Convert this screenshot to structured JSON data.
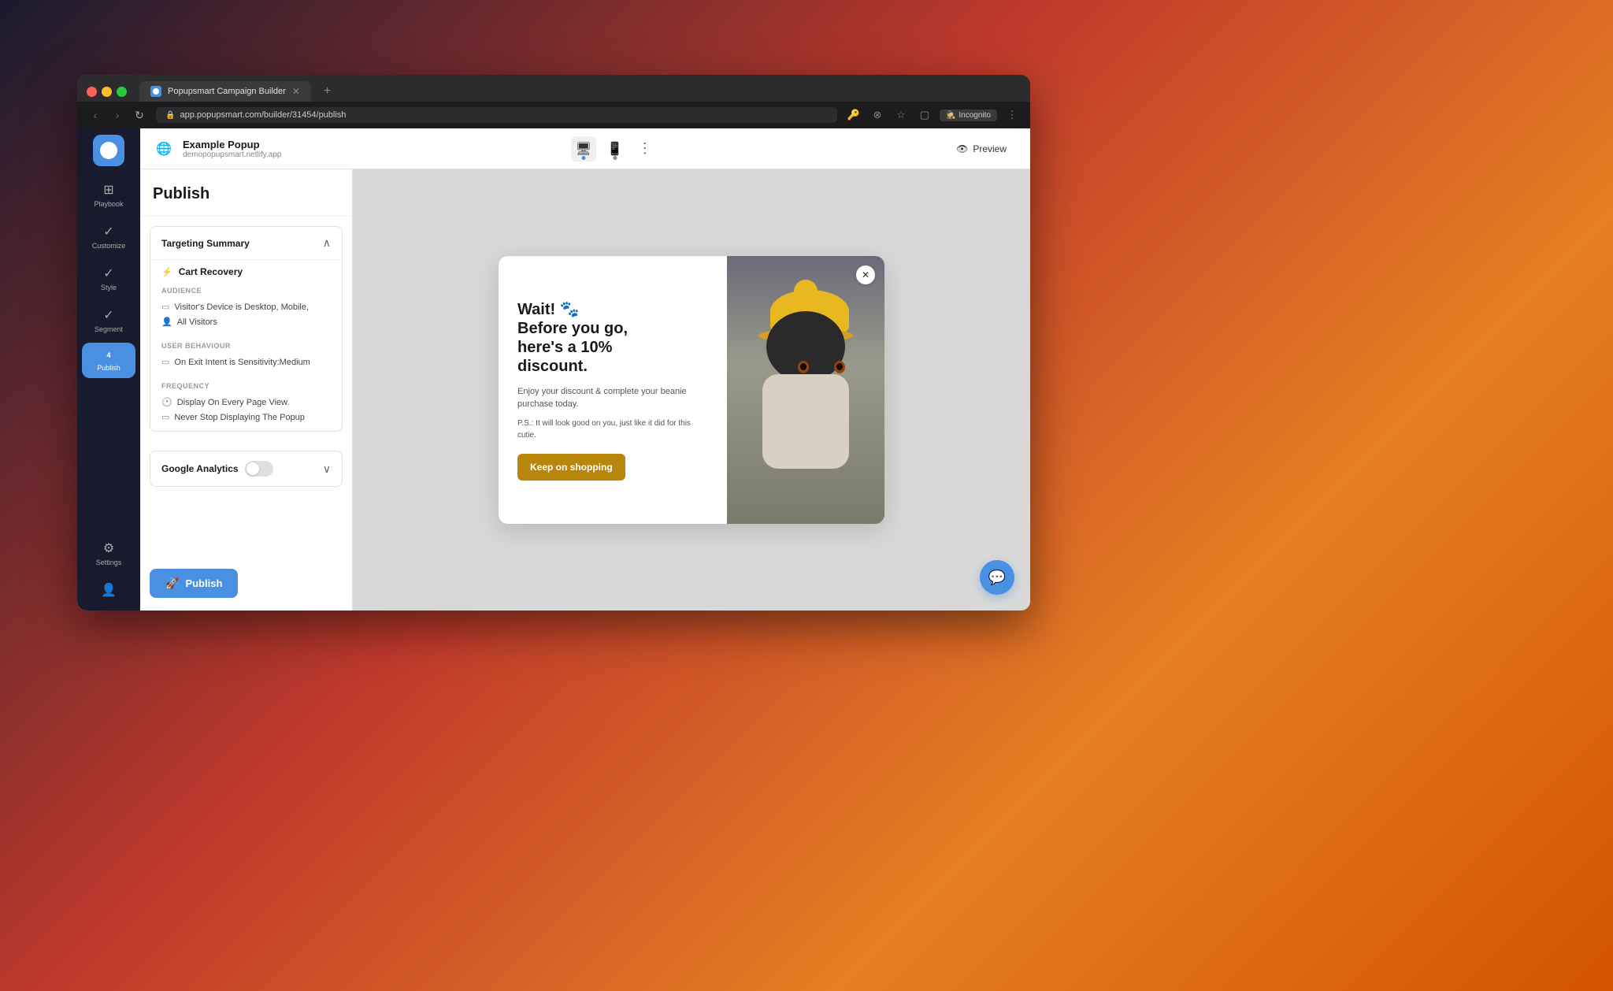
{
  "browser": {
    "tab_title": "Popupsmart Campaign Builder",
    "url": "app.popupsmart.com/builder/31454/publish",
    "incognito_label": "Incognito",
    "nav": {
      "back": "‹",
      "forward": "›",
      "reload": "↻"
    }
  },
  "app_header": {
    "popup_name": "Example Popup",
    "popup_url": "demopopupsmart.netlify.app",
    "preview_label": "Preview"
  },
  "sidebar": {
    "items": [
      {
        "id": "playbook",
        "label": "Playbook",
        "icon": "⊞",
        "type": "grid"
      },
      {
        "id": "customize",
        "label": "Customize",
        "icon": "✓",
        "type": "check"
      },
      {
        "id": "style",
        "label": "Style",
        "icon": "✓",
        "type": "check"
      },
      {
        "id": "segment",
        "label": "Segment",
        "icon": "✓",
        "type": "check"
      },
      {
        "id": "publish",
        "label": "Publish",
        "icon": "4",
        "type": "number",
        "active": true
      }
    ],
    "settings_label": "Settings"
  },
  "publish_panel": {
    "title": "Publish",
    "targeting_summary": {
      "section_title": "Targeting Summary",
      "playbook": {
        "icon": "⚡",
        "label": "Cart Recovery"
      },
      "audience": {
        "group_label": "AUDIENCE",
        "items": [
          {
            "icon": "▭",
            "text": "Visitor's Device is Desktop, Mobile,"
          },
          {
            "icon": "👤",
            "text": "All Visitors"
          }
        ]
      },
      "user_behaviour": {
        "group_label": "USER BEHAVIOUR",
        "items": [
          {
            "icon": "▭",
            "text": "On Exit Intent is Sensitivity:Medium"
          }
        ]
      },
      "frequency": {
        "group_label": "FREQUENCY",
        "items": [
          {
            "icon": "🕐",
            "text": "Display On Every Page View."
          },
          {
            "icon": "▭",
            "text": "Never Stop Displaying The Popup"
          }
        ]
      }
    },
    "google_analytics": {
      "title": "Google Analytics",
      "toggle_active": false
    },
    "publish_button": "Publish"
  },
  "popup_preview": {
    "emoji": "🐾",
    "headline": "Wait! 🐾\nBefore you go,\nhere's a 10%\ndiscount.",
    "headline_line1": "Wait! 🐾",
    "headline_line2": "Before you go,",
    "headline_line3": "here's a 10%",
    "headline_line4": "discount.",
    "body": "Enjoy your discount & complete your beanie purchase today.",
    "ps": "P.S.: It will look good on you, just like it did for this cutie.",
    "cta_button": "Keep on shopping"
  },
  "colors": {
    "blue_accent": "#4a90e2",
    "gold_cta": "#b8860b",
    "hat_gold": "#e8b820"
  }
}
